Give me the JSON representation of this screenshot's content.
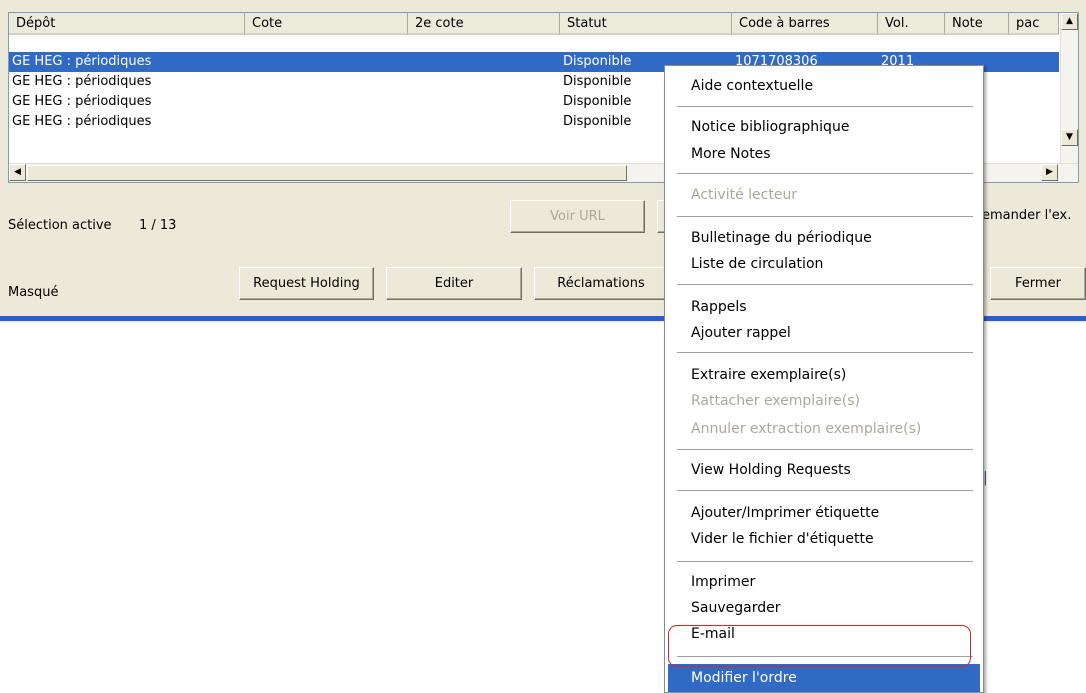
{
  "table": {
    "columns": [
      "Dépôt",
      "Cote",
      "2e cote",
      "Statut",
      "Code à barres",
      "Vol.",
      "Note",
      "pac"
    ],
    "rows": [
      {
        "depot": "GE HEG : périodiques",
        "cote": "",
        "cote2": "",
        "statut": "Disponible",
        "barcode": "1071708306",
        "vol": "2011",
        "note": "",
        "pac": ""
      },
      {
        "depot": "GE HEG : périodiques",
        "cote": "",
        "cote2": "",
        "statut": "Disponible",
        "barcode": "",
        "vol": "",
        "note": "",
        "pac": ""
      },
      {
        "depot": "GE HEG : périodiques",
        "cote": "",
        "cote2": "",
        "statut": "Disponible",
        "barcode": "",
        "vol": "",
        "note": "",
        "pac": ""
      },
      {
        "depot": "GE HEG : périodiques",
        "cote": "",
        "cote2": "",
        "statut": "Disponible",
        "barcode": "",
        "vol": "",
        "note": "",
        "pac": ""
      }
    ]
  },
  "selection": {
    "label": "Sélection active",
    "value": "1 / 13"
  },
  "buttons": {
    "voir_url": "Voir URL",
    "demander": "emander l'ex.",
    "request_holding": "Request Holding",
    "editer": "Editer",
    "reclamations": "Réclamations",
    "fermer": "Fermer"
  },
  "masque_label": "Masqué",
  "context_menu": {
    "items": [
      {
        "label": "Aide contextuelle",
        "enabled": true
      },
      {
        "label": "Notice bibliographique",
        "enabled": true
      },
      {
        "label": "More Notes",
        "enabled": true
      },
      {
        "label": "Activité lecteur",
        "enabled": false
      },
      {
        "label": "Bulletinage du périodique",
        "enabled": true
      },
      {
        "label": "Liste de circulation",
        "enabled": true
      },
      {
        "label": "Rappels",
        "enabled": true
      },
      {
        "label": "Ajouter rappel",
        "enabled": true
      },
      {
        "label": "Extraire exemplaire(s)",
        "enabled": true
      },
      {
        "label": "Rattacher exemplaire(s)",
        "enabled": false
      },
      {
        "label": "Annuler extraction exemplaire(s)",
        "enabled": false
      },
      {
        "label": "View Holding Requests",
        "enabled": true
      },
      {
        "label": "Ajouter/Imprimer étiquette",
        "enabled": true
      },
      {
        "label": "Vider le fichier d'étiquette",
        "enabled": true
      },
      {
        "label": "Imprimer",
        "enabled": true
      },
      {
        "label": "Sauvegarder",
        "enabled": true
      },
      {
        "label": "E-mail",
        "enabled": true
      },
      {
        "label": "Modifier l'ordre",
        "enabled": true,
        "highlighted": true
      }
    ]
  },
  "colors": {
    "selection": "#316ac5",
    "annotation": "#d62828"
  }
}
